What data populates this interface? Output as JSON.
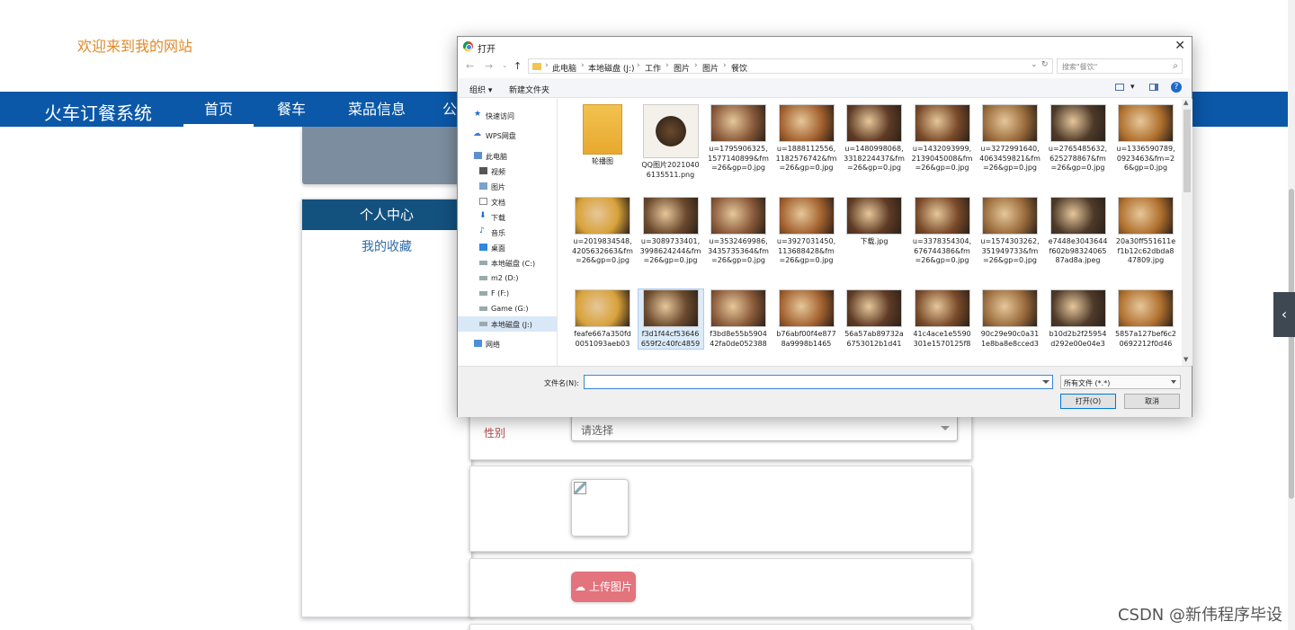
{
  "site": {
    "welcome": "欢迎来到我的网站",
    "brand": "火车订餐系统",
    "nav": [
      "首页",
      "餐车",
      "菜品信息",
      "公"
    ],
    "side_title": "个人中心",
    "side_link": "我的收藏",
    "gender_label": "性别",
    "gender_placeholder": "请选择",
    "upload_label": "上传图片",
    "watermark": "CSDN @新伟程序毕设",
    "toggle_glyph": "‹"
  },
  "dialog": {
    "title": "打开",
    "close": "✕",
    "breadcrumbs": [
      "此电脑",
      "本地磁盘 (J:)",
      "工作",
      "图片",
      "图片",
      "餐饮"
    ],
    "search_placeholder": "搜索\"餐饮\"",
    "toolbar": {
      "organize": "组织 ▾",
      "new_folder": "新建文件夹",
      "help": "?"
    },
    "nav": [
      "快速访问",
      "WPS网盘",
      "此电脑",
      "视频",
      "图片",
      "文档",
      "下载",
      "音乐",
      "桌面",
      "本地磁盘 (C:)",
      "m2 (D:)",
      "F (F:)",
      "Game (G:)",
      "本地磁盘 (J:)",
      "网络"
    ],
    "files": [
      "轮播图",
      "QQ图片20210406135511.png",
      "u=1795906325,1577140899&fm=26&gp=0.jpg",
      "u=1888112556,1182576742&fm=26&gp=0.jpg",
      "u=1480998068,3318224437&fm=26&gp=0.jpg",
      "u=1432093999,2139045008&fm=26&gp=0.jpg",
      "u=3272991640,4063459821&fm=26&gp=0.jpg",
      "u=2765485632,625278867&fm=26&gp=0.jpg",
      "u=1336590789,0923463&fm=26&gp=0.jpg",
      "u=2019834548,4205632663&fm=26&gp=0.jpg",
      "u=3089733401,3998624244&fm=26&gp=0.jpg",
      "u=3532469986,3435735364&fm=26&gp=0.jpg",
      "u=3927031450,113688428&fm=26&gp=0.jpg",
      "下载.jpg",
      "u=3378354304,676744386&fm=26&gp=0.jpg",
      "u=1574303262,351949733&fm=26&gp=0.jpg",
      "e7448e3043644f602b9832406587ad8a.jpeg",
      "20a30ff551611ef1b12c62dbda847809.jpg",
      "feafe667a350fd0051093aeb03",
      "f3d1f44cf53646659f2c40fc4859",
      "f3bd8e55b590442fa0de052388",
      "b76abf00f4e8778a9998b1465",
      "56a57ab89732a6753012b1d41",
      "41c4ace1e5590301e1570125f8",
      "90c29e90c0a311e8ba8e8cced3",
      "b10d2b2f25954d292e00e04e3",
      "5857a127bef6c20692212f0d46"
    ],
    "filename_label": "文件名(N):",
    "filename_value": "",
    "filter": "所有文件 (*.*)",
    "open_button": "打开(O)",
    "cancel_button": "取消"
  },
  "colors": {
    "navbar": "#0b58a8",
    "welcome": "#e08a2a",
    "upload": "#e3737c",
    "side_head": "#13517f"
  }
}
